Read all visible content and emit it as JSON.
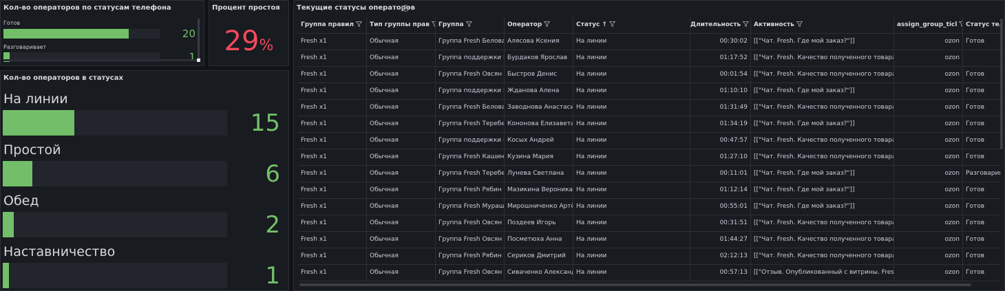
{
  "phone_panel": {
    "title": "Кол-во операторов по статусам телефона",
    "rows": [
      {
        "label": "Готов",
        "value": "20",
        "fill": 0.08
      },
      {
        "label": "Разговаривает",
        "value": "1",
        "fill": 0.004
      }
    ]
  },
  "idle_panel": {
    "title": "Процент простоя",
    "value": "29",
    "unit": "%"
  },
  "status_panel": {
    "title": "Кол-во операторов в статусах",
    "rows": [
      {
        "label": "На линии",
        "value": "15",
        "fill": 0.06
      },
      {
        "label": "Простой",
        "value": "6",
        "fill": 0.025
      },
      {
        "label": "Обед",
        "value": "2",
        "fill": 0.009
      },
      {
        "label": "Наставничество",
        "value": "1",
        "fill": 0.005
      }
    ]
  },
  "table_panel": {
    "title": "Текущие статусы операторов",
    "info_icon": "ⓘ",
    "headers": [
      "Группа правил",
      "Тип группы прав",
      "Группа",
      "Оператор",
      "Статус",
      "Длительность",
      "Активность",
      "assign_group_ticl",
      "Статус теле"
    ],
    "sort_arrow": "↑",
    "rows": [
      [
        "Fresh x1",
        "Обычная",
        "Группа Fresh Белова",
        "Алясова Ксения",
        "На линии",
        "00:30:02",
        "[[\"Чат. Fresh. Где мой заказ?\"]]",
        "ozon",
        "Готов"
      ],
      [
        "Fresh x1",
        "Обычная",
        "Группа поддержки F",
        "Бурдаков Ярослав",
        "На линии",
        "01:17:52",
        "[[\"Чат. Fresh. Качество полученного товара",
        "ozon",
        ""
      ],
      [
        "Fresh x1",
        "Обычная",
        "Группа Fresh Овсян",
        "Быстров Денис",
        "На линии",
        "00:01:54",
        "[[\"Чат. Fresh. Качество полученного товара",
        "ozon",
        "Готов"
      ],
      [
        "Fresh x1",
        "Обычная",
        "Группа поддержки F",
        "Жданова Алена",
        "На линии",
        "01:10:10",
        "[[\"Чат. Fresh. Где мой заказ?\"]]",
        "ozon",
        "Готов"
      ],
      [
        "Fresh x1",
        "Обычная",
        "Группа Fresh Белова",
        "Заводнова Анастаси",
        "На линии",
        "01:31:49",
        "[[\"Чат. Fresh. Качество полученного товара",
        "ozon",
        "Готов"
      ],
      [
        "Fresh x1",
        "Обычная",
        "Группа Fresh Теребе",
        "Кононова Елизавета",
        "На линии",
        "01:34:19",
        "[[\"Чат. Fresh. Где мой заказ?\"]]",
        "ozon",
        "Готов"
      ],
      [
        "Fresh x1",
        "Обычная",
        "Группа поддержки F",
        "Косых Андрей",
        "На линии",
        "00:47:57",
        "[[\"Чат. Fresh. Качество полученного товара",
        "ozon",
        "Готов"
      ],
      [
        "Fresh x1",
        "Обычная",
        "Группа Fresh Кашин",
        "Кузина Мария",
        "На линии",
        "01:27:10",
        "[[\"Чат. Fresh. Качество полученного товара",
        "ozon",
        "Готов"
      ],
      [
        "Fresh x1",
        "Обычная",
        "Группа Fresh Теребе",
        "Лунева Светлана",
        "На линии",
        "00:11:01",
        "[[\"Чат. Fresh. Где мой заказ?\"]]",
        "ozon",
        "Разговарив"
      ],
      [
        "Fresh x1",
        "Обычная",
        "Группа Fresh Рябин",
        "Мазикина Вероника",
        "На линии",
        "01:12:14",
        "[[\"Чат. Fresh. Где мой заказ?\"]]",
        "ozon",
        "Готов"
      ],
      [
        "Fresh x1",
        "Обычная",
        "Группа Fresh Мураш",
        "Мирошниченко Артё",
        "На линии",
        "00:55:01",
        "[[\"Чат. Fresh. Где мой заказ?\"]]",
        "ozon",
        "Готов"
      ],
      [
        "Fresh x1",
        "Обычная",
        "Группа Fresh Овсян",
        "Поздеев Игорь",
        "На линии",
        "00:31:51",
        "[[\"Чат. Fresh. Качество полученного товара",
        "ozon",
        "Готов"
      ],
      [
        "Fresh x1",
        "Обычная",
        "Группа Fresh Овсян",
        "Посметюха Анна",
        "На линии",
        "01:44:27",
        "[[\"Чат. Fresh. Качество полученного товара",
        "ozon",
        "Готов"
      ],
      [
        "Fresh x1",
        "Обычная",
        "Группа Fresh Рябин",
        "Сериков Дмитрий",
        "На линии",
        "02:12:13",
        "[[\"Чат. Fresh. Качество полученного товара",
        "ozon",
        "Готов"
      ],
      [
        "Fresh x1",
        "Обычная",
        "Группа Fresh Овсян",
        "Сиваченко Александ",
        "На линии",
        "00:57:13",
        "[[\"Отзыв. Опубликованный с витрины. Fresh",
        "ozon",
        "Готов"
      ]
    ]
  },
  "colors": {
    "background": "#111217",
    "panel": "#181b1f",
    "green": "#73bf69",
    "red": "#f2495c"
  }
}
